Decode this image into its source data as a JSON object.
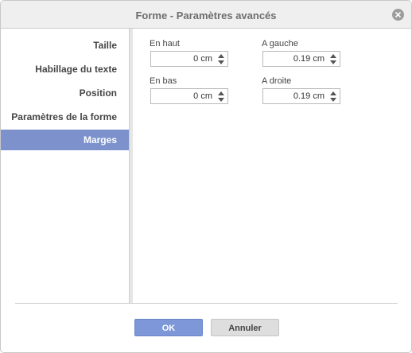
{
  "dialog": {
    "title": "Forme - Paramètres avancés"
  },
  "sidebar": {
    "items": [
      {
        "label": "Taille",
        "active": false
      },
      {
        "label": "Habillage du texte",
        "active": false
      },
      {
        "label": "Position",
        "active": false
      },
      {
        "label": "Paramètres de la forme",
        "active": false
      },
      {
        "label": "Marges",
        "active": true
      }
    ]
  },
  "margins": {
    "top": {
      "label": "En haut",
      "value": "0 cm"
    },
    "left": {
      "label": "A gauche",
      "value": "0.19 cm"
    },
    "bottom": {
      "label": "En bas",
      "value": "0 cm"
    },
    "right": {
      "label": "A droite",
      "value": "0.19 cm"
    }
  },
  "footer": {
    "ok_label": "OK",
    "cancel_label": "Annuler"
  },
  "colors": {
    "accent": "#7d92cc",
    "ok_button": "#7d97d8",
    "titlebar": "#efefef"
  }
}
